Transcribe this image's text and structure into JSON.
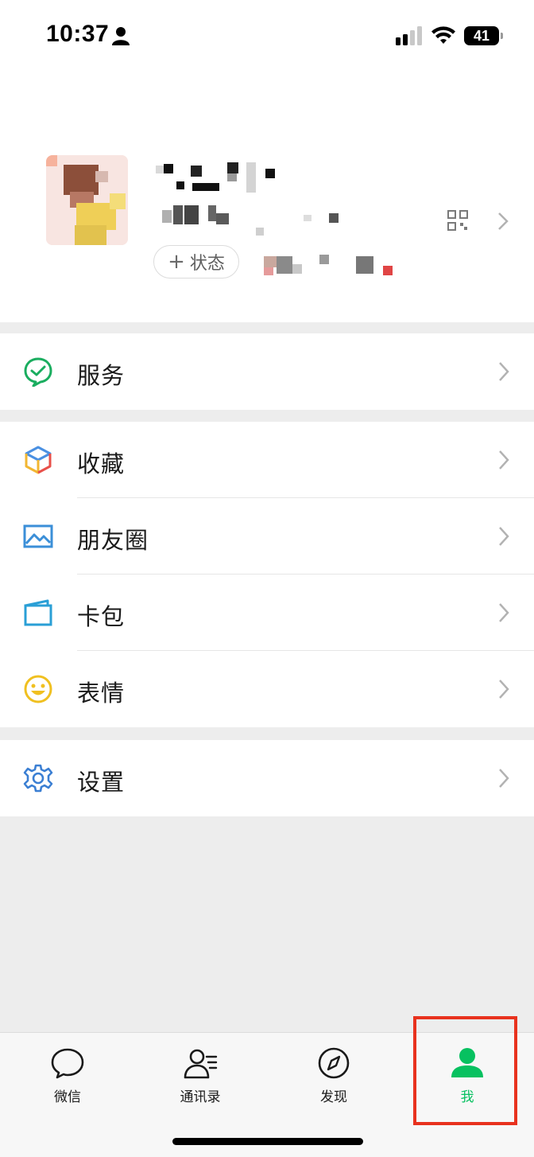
{
  "status_bar": {
    "time": "10:37",
    "battery": "41"
  },
  "profile": {
    "status_button_label": "状态",
    "status_button_plus": "+"
  },
  "menu": {
    "services": {
      "label": "服务"
    },
    "favorites": {
      "label": "收藏"
    },
    "moments": {
      "label": "朋友圈"
    },
    "cards": {
      "label": "卡包"
    },
    "stickers": {
      "label": "表情"
    },
    "settings": {
      "label": "设置"
    }
  },
  "tabbar": {
    "tabs": [
      {
        "label": "微信",
        "icon": "chat-bubble-icon",
        "active": false
      },
      {
        "label": "通讯录",
        "icon": "contacts-icon",
        "active": false
      },
      {
        "label": "发现",
        "icon": "compass-icon",
        "active": false
      },
      {
        "label": "我",
        "icon": "person-icon",
        "active": true
      }
    ]
  },
  "colors": {
    "accent": "#07c160",
    "highlight": "#e8321e",
    "background": "#ededed"
  }
}
